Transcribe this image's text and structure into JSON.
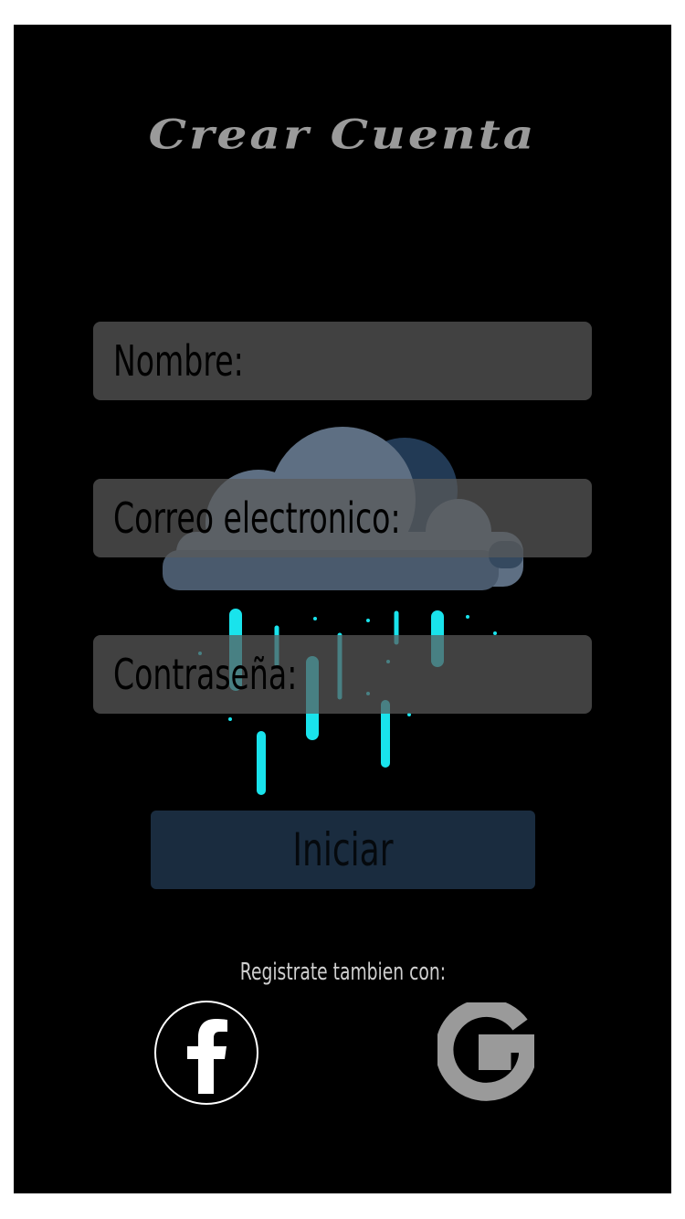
{
  "app": {
    "title": "Crear Cuenta"
  },
  "form": {
    "name_placeholder": "Nombre:",
    "email_placeholder": "Correo electronico:",
    "password_placeholder": "Contraseña:"
  },
  "actions": {
    "submit_label": "Iniciar"
  },
  "social": {
    "prompt": "Registrate tambien con:",
    "providers": [
      "facebook-icon",
      "google-icon"
    ]
  },
  "colors": {
    "background": "#000000",
    "field": "#5a5a5a",
    "button": "#1a2c3f",
    "rain": "#19e3ec",
    "title": "#9a9a9a"
  }
}
